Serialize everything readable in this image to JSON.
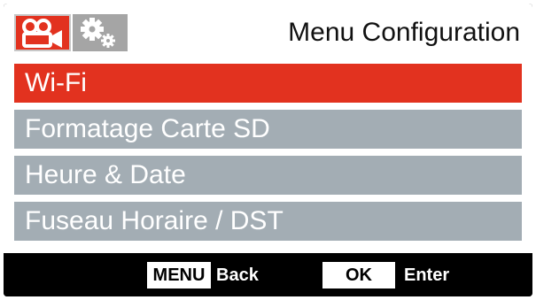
{
  "header": {
    "title": "Menu Configuration",
    "tabs": [
      {
        "icon": "video-camera-icon",
        "active": true
      },
      {
        "icon": "settings-gears-icon",
        "active": false
      }
    ]
  },
  "menu": {
    "items": [
      {
        "label": "Wi-Fi",
        "selected": true
      },
      {
        "label": "Formatage Carte SD",
        "selected": false
      },
      {
        "label": "Heure & Date",
        "selected": false
      },
      {
        "label": "Fuseau Horaire / DST",
        "selected": false
      }
    ]
  },
  "footer": {
    "menu_key": "MENU",
    "menu_action": "Back",
    "ok_key": "OK",
    "ok_action": "Enter"
  },
  "colors": {
    "accent": "#e2321f",
    "item_bg": "#a3adb4",
    "inactive_tab": "#a5a5a5"
  }
}
